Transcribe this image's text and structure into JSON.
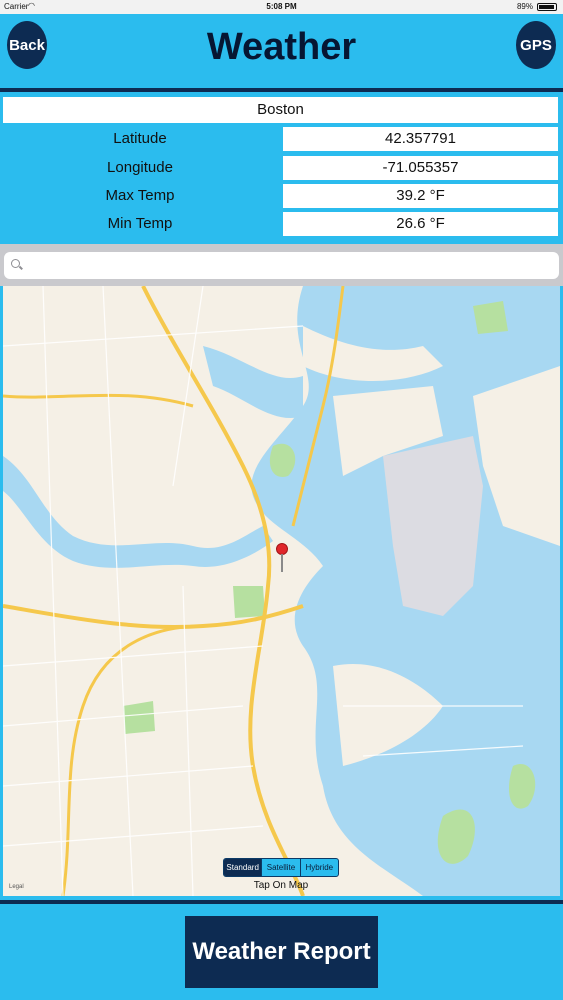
{
  "status_bar": {
    "carrier": "Carrier",
    "time": "5:08 PM",
    "battery": "89%"
  },
  "navbar": {
    "back_label": "Back",
    "title": "Weather",
    "gps_label": "GPS"
  },
  "location": {
    "city": "Boston",
    "rows": [
      {
        "label": "Latitude",
        "value": "42.357791"
      },
      {
        "label": "Longitude",
        "value": "-71.055357"
      },
      {
        "label": "Max Temp",
        "value": "39.2 °F"
      },
      {
        "label": "Min Temp",
        "value": "26.6 °F"
      }
    ]
  },
  "search": {
    "placeholder": ""
  },
  "map": {
    "legal": "Legal",
    "map_types": [
      "Standard",
      "Satellite",
      "Hybride"
    ],
    "selected_type": "Standard",
    "tap_hint": "Tap On Map",
    "colors": {
      "land": "#f5f0e6",
      "water": "#a8d8f2",
      "park": "#b6e0a0",
      "road": "#f5c84c"
    }
  },
  "footer": {
    "report_label": "Weather Report"
  },
  "colors": {
    "accent": "#2bbcee",
    "dark": "#0d2b52"
  }
}
